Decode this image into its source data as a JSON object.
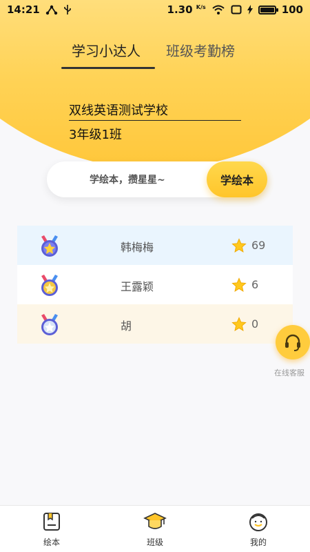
{
  "status_bar": {
    "time": "14:21",
    "speed": "1.30",
    "speed_unit": "K/s",
    "battery": "100",
    "battery_level": 1.0,
    "icons": [
      "share-icon",
      "usb-icon",
      "wifi-icon",
      "screen-icon",
      "charging-icon",
      "battery-icon"
    ]
  },
  "tabs": [
    {
      "label": "学习小达人",
      "active": true
    },
    {
      "label": "班级考勤榜",
      "active": false
    }
  ],
  "school": {
    "name": "双线英语测试学校",
    "class": "3年级1班"
  },
  "search": {
    "hint": "学绘本，攒星星~",
    "button": "学绘本"
  },
  "ranking": [
    {
      "medal": "gold-medal-icon",
      "name": "韩梅梅",
      "stars": "69"
    },
    {
      "medal": "silver-medal-icon",
      "name": "王露颖",
      "stars": "6"
    },
    {
      "medal": "bronze-medal-icon",
      "name": "胡",
      "stars": "0"
    }
  ],
  "service": {
    "icon": "headset-icon",
    "label": "在线客服"
  },
  "bottom_nav": [
    {
      "label": "绘本",
      "icon": "book-icon"
    },
    {
      "label": "班级",
      "icon": "graduation-cap-icon"
    },
    {
      "label": "我的",
      "icon": "smiley-icon"
    }
  ],
  "colors": {
    "accent": "#ffc52a",
    "row1_bg": "#eaf5fe",
    "row2_bg": "#ffffff",
    "row3_bg": "#fdf6e7"
  }
}
